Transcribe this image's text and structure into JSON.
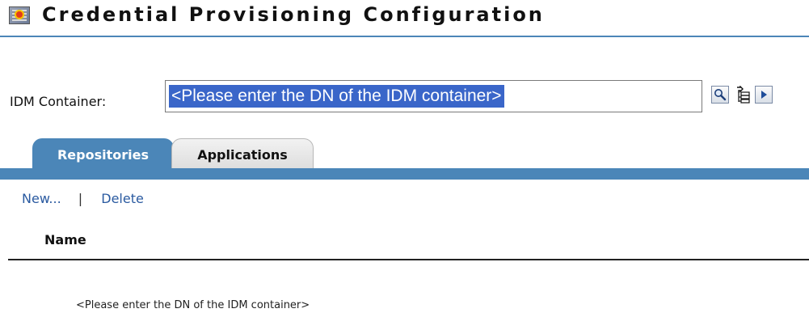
{
  "header": {
    "title": "Credential Provisioning Configuration",
    "icon": "config-icon"
  },
  "idm": {
    "label": "IDM Container:",
    "value": "<Please enter the DN of the IDM container>",
    "buttons": [
      "search-icon",
      "tree-browse-icon",
      "arrow-right-icon"
    ]
  },
  "tabs": [
    {
      "label": "Repositories",
      "active": true
    },
    {
      "label": "Applications",
      "active": false
    }
  ],
  "actions": {
    "new_label": "New...",
    "separator": "|",
    "delete_label": "Delete"
  },
  "table": {
    "columns": [
      "Name"
    ]
  },
  "message": "<Please enter the DN of the IDM container>",
  "colors": {
    "accent": "#4b86b8",
    "link": "#2a5aa0",
    "selection": "#3a66c9"
  }
}
